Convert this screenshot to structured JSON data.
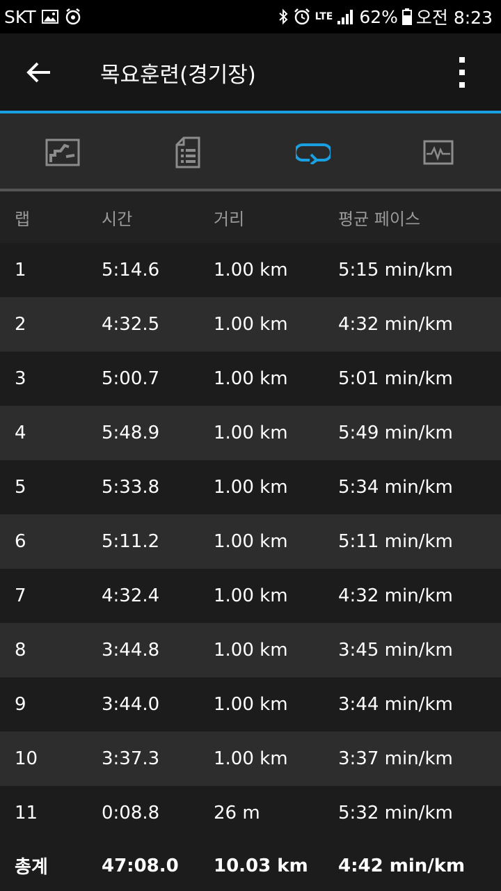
{
  "status_bar": {
    "carrier": "SKT",
    "network": "LTE",
    "battery": "62%",
    "time": "오전 8:23"
  },
  "app_bar": {
    "title": "목요훈련(경기장)"
  },
  "tabs": [
    {
      "icon": "map-icon",
      "selected": false
    },
    {
      "icon": "details-icon",
      "selected": false
    },
    {
      "icon": "laps-icon",
      "selected": true
    },
    {
      "icon": "chart-icon",
      "selected": false
    }
  ],
  "table": {
    "headers": {
      "lap": "랩",
      "time": "시간",
      "distance": "거리",
      "pace": "평균 페이스"
    },
    "rows": [
      {
        "lap": "1",
        "time": "5:14.6",
        "distance": "1.00 km",
        "pace": "5:15 min/km"
      },
      {
        "lap": "2",
        "time": "4:32.5",
        "distance": "1.00 km",
        "pace": "4:32 min/km"
      },
      {
        "lap": "3",
        "time": "5:00.7",
        "distance": "1.00 km",
        "pace": "5:01 min/km"
      },
      {
        "lap": "4",
        "time": "5:48.9",
        "distance": "1.00 km",
        "pace": "5:49 min/km"
      },
      {
        "lap": "5",
        "time": "5:33.8",
        "distance": "1.00 km",
        "pace": "5:34 min/km"
      },
      {
        "lap": "6",
        "time": "5:11.2",
        "distance": "1.00 km",
        "pace": "5:11 min/km"
      },
      {
        "lap": "7",
        "time": "4:32.4",
        "distance": "1.00 km",
        "pace": "4:32 min/km"
      },
      {
        "lap": "8",
        "time": "3:44.8",
        "distance": "1.00 km",
        "pace": "3:45 min/km"
      },
      {
        "lap": "9",
        "time": "3:44.0",
        "distance": "1.00 km",
        "pace": "3:44 min/km"
      },
      {
        "lap": "10",
        "time": "3:37.3",
        "distance": "1.00 km",
        "pace": "3:37 min/km"
      },
      {
        "lap": "11",
        "time": "0:08.8",
        "distance": "26 m",
        "pace": "5:32 min/km"
      }
    ],
    "total": {
      "lap": "총계",
      "time": "47:08.0",
      "distance": "10.03 km",
      "pace": "4:42 min/km"
    }
  },
  "colors": {
    "accent": "#1a9fe0",
    "background": "#1b1b1b",
    "row_alt": "#2d2d2d",
    "header_text": "#9a9a9a"
  }
}
